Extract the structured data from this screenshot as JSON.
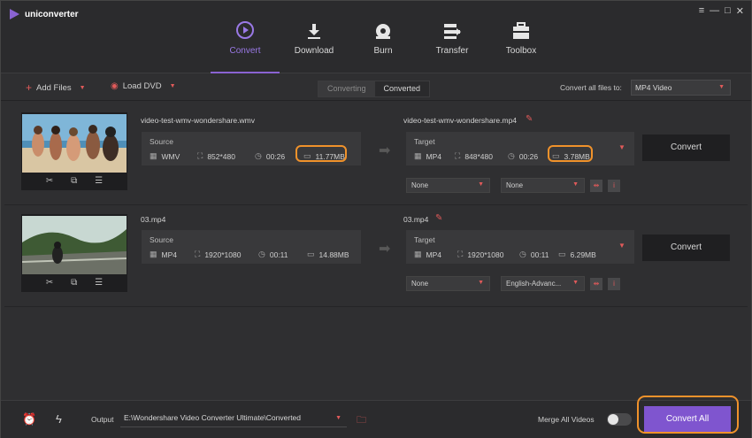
{
  "app": {
    "name": "uniconverter",
    "window_controls": [
      "≡",
      "—",
      "□",
      "✕"
    ]
  },
  "nav": {
    "items": [
      {
        "label": "Convert",
        "icon": "convert-icon",
        "active": true
      },
      {
        "label": "Download",
        "icon": "download-icon",
        "active": false
      },
      {
        "label": "Burn",
        "icon": "burn-icon",
        "active": false
      },
      {
        "label": "Transfer",
        "icon": "transfer-icon",
        "active": false
      },
      {
        "label": "Toolbox",
        "icon": "toolbox-icon",
        "active": false
      }
    ]
  },
  "toolbar": {
    "add_files": "Add Files",
    "load_dvd": "Load DVD",
    "tabs": [
      "Converting",
      "Converted"
    ],
    "convert_all_label": "Convert all files to:",
    "convert_all_format": "MP4 Video"
  },
  "files": [
    {
      "source_name": "video-test-wmv-wondershare.wmv",
      "target_name": "video-test-wmv-wondershare.mp4",
      "source": {
        "title": "Source",
        "format": "WMV",
        "resolution": "852*480",
        "duration": "00:26",
        "size": "11.77MB"
      },
      "target": {
        "title": "Target",
        "format": "MP4",
        "resolution": "848*480",
        "duration": "00:26",
        "size": "3.78MB"
      },
      "subtitle": "None",
      "audio": "None",
      "convert_label": "Convert"
    },
    {
      "source_name": "03.mp4",
      "target_name": "03.mp4",
      "source": {
        "title": "Source",
        "format": "MP4",
        "resolution": "1920*1080",
        "duration": "00:11",
        "size": "14.88MB"
      },
      "target": {
        "title": "Target",
        "format": "MP4",
        "resolution": "1920*1080",
        "duration": "00:11",
        "size": "6.29MB"
      },
      "subtitle": "None",
      "audio": "English-Advanc...",
      "convert_label": "Convert"
    }
  ],
  "bottom": {
    "output_label": "Output",
    "output_path": "E:\\Wondershare Video Converter Ultimate\\Converted",
    "merge_label": "Merge All Videos",
    "merge_on": false,
    "convert_all": "Convert All"
  },
  "colors": {
    "accent": "#8a63d2",
    "highlight": "#f0922b",
    "caret": "#e05a5a",
    "background": "#2f2f31"
  }
}
